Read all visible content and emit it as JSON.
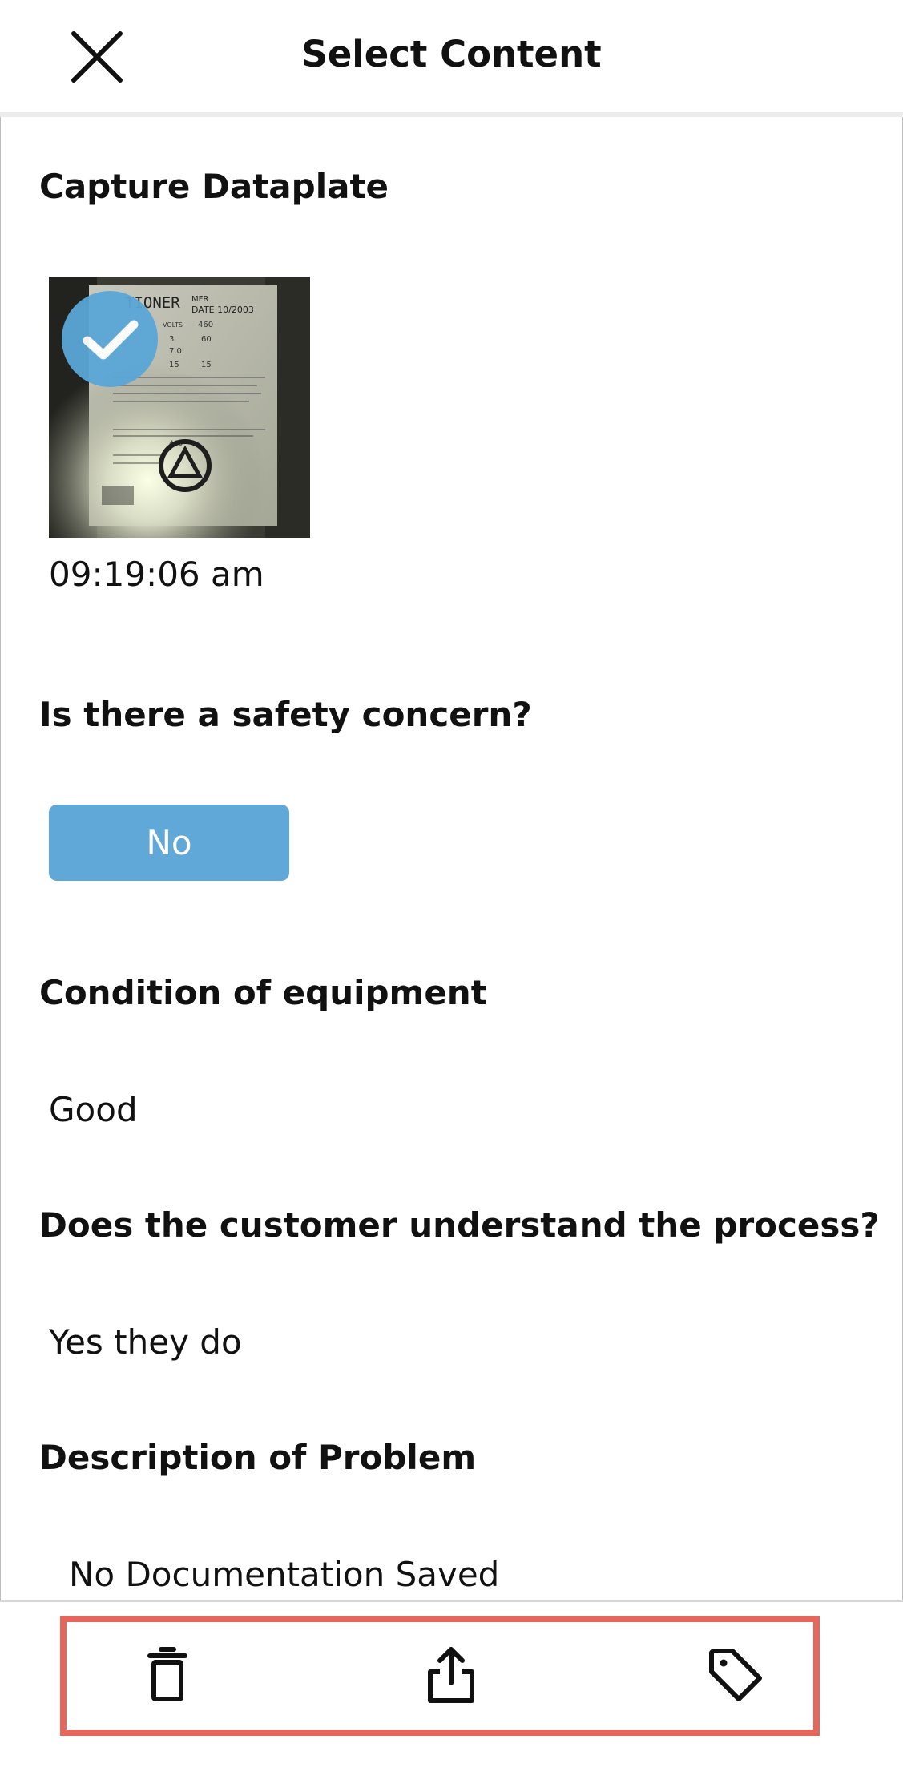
{
  "header": {
    "title": "Select Content",
    "close_icon": "close-icon"
  },
  "sections": {
    "capture": {
      "title": "Capture Dataplate",
      "photo": {
        "timestamp": "09:19:06 am",
        "selected": true,
        "nameplate_lines": [
          "TIONER",
          "MFR",
          "DATE 10/2003",
          "VOLTS",
          "460",
          "60",
          "7.0",
          "15",
          "15",
          "3",
          "460"
        ]
      }
    },
    "safety": {
      "title": "Is there a safety concern?",
      "answer_button": "No"
    },
    "condition": {
      "title": "Condition of equipment",
      "value": "Good"
    },
    "customer": {
      "title": "Does the customer understand the process?",
      "value": "Yes they do"
    },
    "problem": {
      "title": "Description of Problem",
      "value": "No Documentation Saved"
    }
  },
  "toolbar": {
    "delete_icon": "trash-icon",
    "share_icon": "share-icon",
    "tag_icon": "tag-icon"
  },
  "colors": {
    "accent": "#5aa6d7",
    "highlight": "#e5665a",
    "divider": "#ececec"
  }
}
